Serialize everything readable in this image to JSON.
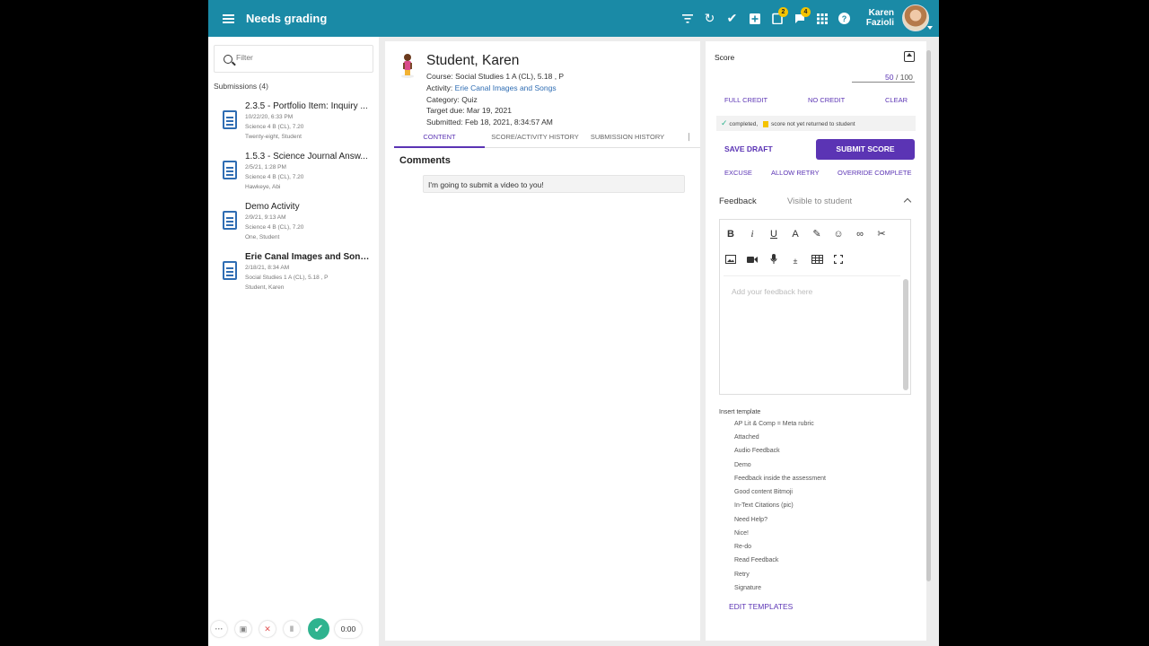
{
  "header": {
    "title": "Needs grading",
    "user_name": "Karen Fazioli",
    "tasks_badge": "2",
    "messages_badge": "4",
    "icons": [
      "filter-icon",
      "refresh-icon",
      "check-icon",
      "add-icon",
      "tasks-icon",
      "messages-icon",
      "apps-icon",
      "help-icon"
    ]
  },
  "colors": {
    "header": "#1a8aa6",
    "accent": "#5b34b4",
    "badge": "#f4c300",
    "success": "#2fb38f",
    "link": "#2f6db3"
  },
  "left": {
    "filter_placeholder": "Filter",
    "submissions_label": "Submissions (4)",
    "items": [
      {
        "title": "2.3.5 - Portfolio Item: Inquiry ...",
        "date": "10/22/20, 6:33 PM",
        "course": "Science 4 B (CL), 7.20",
        "student": "Twenty-eight, Student"
      },
      {
        "title": "1.5.3 - Science Journal Answ...",
        "date": "2/5/21, 1:28 PM",
        "course": "Science 4 B (CL), 7.20",
        "student": "Hawkeye, Abi"
      },
      {
        "title": "Demo Activity",
        "date": "2/9/21, 9:13 AM",
        "course": "Science 4 B (CL), 7.20",
        "student": "One, Student"
      },
      {
        "title": "Erie Canal Images and Songs",
        "date": "2/18/21, 8:34 AM",
        "course": "Social Studies 1 A (CL), 5.18 , P",
        "student": "Student, Karen"
      }
    ]
  },
  "recorder": {
    "more": "···",
    "timer": "0:00"
  },
  "middle": {
    "student_name": "Student, Karen",
    "course_label": "Course:",
    "course": "Social Studies 1 A (CL), 5.18 , P",
    "activity_label": "Activity:",
    "activity": "Erie Canal Images and Songs",
    "category_label": "Category:",
    "category": "Quiz",
    "target_due_label": "Target due:",
    "target_due": "Mar 19, 2021",
    "submitted_label": "Submitted:",
    "submitted": "Feb 18, 2021, 8:34:57 AM",
    "tabs": [
      "CONTENT",
      "SCORE/ACTIVITY HISTORY",
      "SUBMISSION HISTORY"
    ],
    "comments_title": "Comments",
    "comment": "I'm going to submit a video to you!"
  },
  "right": {
    "score_label": "Score",
    "score_value": "50",
    "score_max": "/ 100",
    "full_credit": "FULL CREDIT",
    "no_credit": "NO CREDIT",
    "clear": "CLEAR",
    "status_completed": "completed,",
    "status_not_returned": "score not yet returned to student",
    "save_draft": "SAVE DRAFT",
    "submit_score": "SUBMIT SCORE",
    "excuse": "EXCUSE",
    "allow_retry": "ALLOW RETRY",
    "override_complete": "OVERRIDE COMPLETE",
    "feedback_label": "Feedback",
    "feedback_visibility": "Visible to student",
    "feedback_placeholder": "Add your feedback here",
    "insert_template_label": "Insert template",
    "templates": [
      "AP Lit & Comp = Meta rubric",
      "Attached",
      "Audio Feedback",
      "Demo",
      "Feedback inside the assessment",
      "Good content Bitmoji",
      "In-Text Citations (pic)",
      "Need Help?",
      "Nice!",
      "Re-do",
      "Read Feedback",
      "Retry",
      "Signature"
    ],
    "edit_templates": "EDIT TEMPLATES"
  }
}
